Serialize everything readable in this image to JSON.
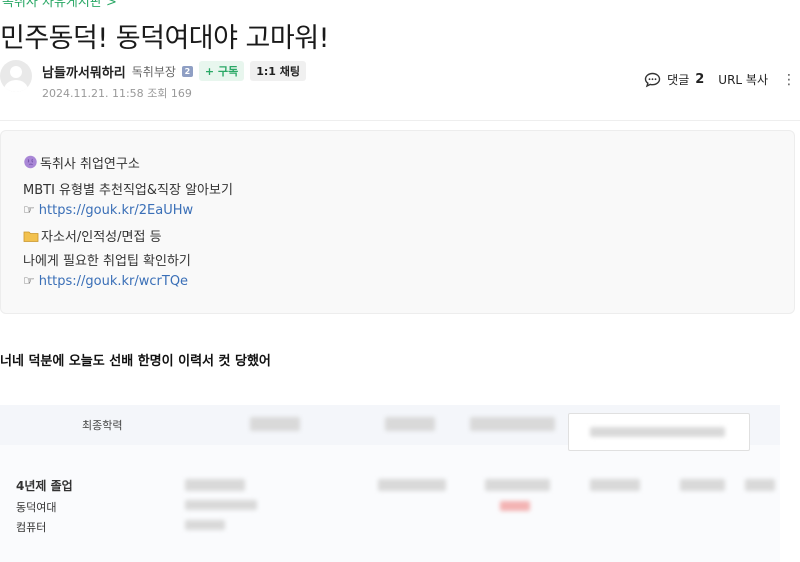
{
  "breadcrumb": "독취사 자유게시판 >",
  "post": {
    "title": "민주동덕! 동덕여대야 고마워!",
    "author": {
      "nickname": "남들까서뭐하리",
      "grade": "독취부장",
      "grade_badge": "2",
      "subscribe_label": "+ 구독",
      "chat_label": "1:1 채팅"
    },
    "date": "2024.11.21. 11:58",
    "views_label": "조회 169",
    "comments": {
      "label": "댓글",
      "count": "2"
    },
    "url_copy_label": "URL 복사",
    "body_text": "너네 덕분에 오늘도 선배 한명이 이력서 컷 당했어"
  },
  "promo": {
    "title": "독취사 취업연구소",
    "line1": "MBTI 유형별 추천직업&직장 알아보기",
    "link1_prefix": "☞",
    "link1": "https://gouk.kr/2EaUHw",
    "line2": "자소서/인적성/면접 등",
    "line3": "나에게 필요한 취업팁 확인하기",
    "link2_prefix": "☞",
    "link2": "https://gouk.kr/wcrTQe"
  },
  "resume": {
    "header_label": "최종학력",
    "row_label": "4년제 졸업",
    "school": "동덕여대",
    "major": "컴퓨터"
  },
  "colors": {
    "accent_green": "#2aa866",
    "link_blue": "#3a6fb7"
  },
  "icons": [
    "speech-bubble-icon",
    "more-vertical-icon",
    "brain-icon",
    "folder-icon",
    "pointing-hand-icon"
  ]
}
